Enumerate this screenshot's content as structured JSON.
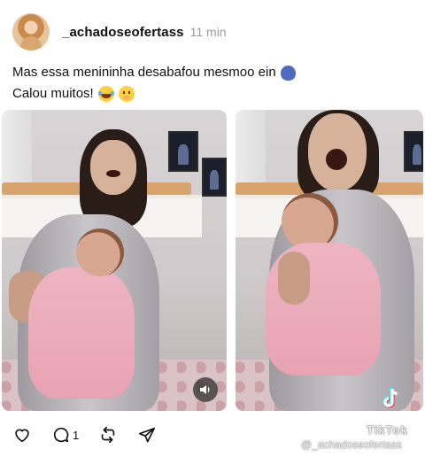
{
  "post": {
    "username": "_achadoseofertass",
    "time": "11 min",
    "caption_line1": "Mas essa menininha desabafou mesmoo ein",
    "caption_line2": "Calou muitos!",
    "caption_line1_emoji": "speaking-head-emoji",
    "caption_line2_emojis": [
      "rolling-laughing-emoji",
      "hushed-face-emoji"
    ]
  },
  "media": [
    {
      "type": "video",
      "description_icon": "sound-icon",
      "has_sound_button": true
    },
    {
      "type": "video",
      "watermark": "TikTok",
      "watermark_handle": "@_achadoseofertass"
    }
  ],
  "actions": {
    "like_icon": "heart-icon",
    "comment_icon": "comment-icon",
    "comment_count": "1",
    "repost_icon": "repost-icon",
    "share_icon": "send-icon"
  },
  "colors": {
    "text": "#101010",
    "muted": "#9a9a9a",
    "background": "#ffffff"
  }
}
